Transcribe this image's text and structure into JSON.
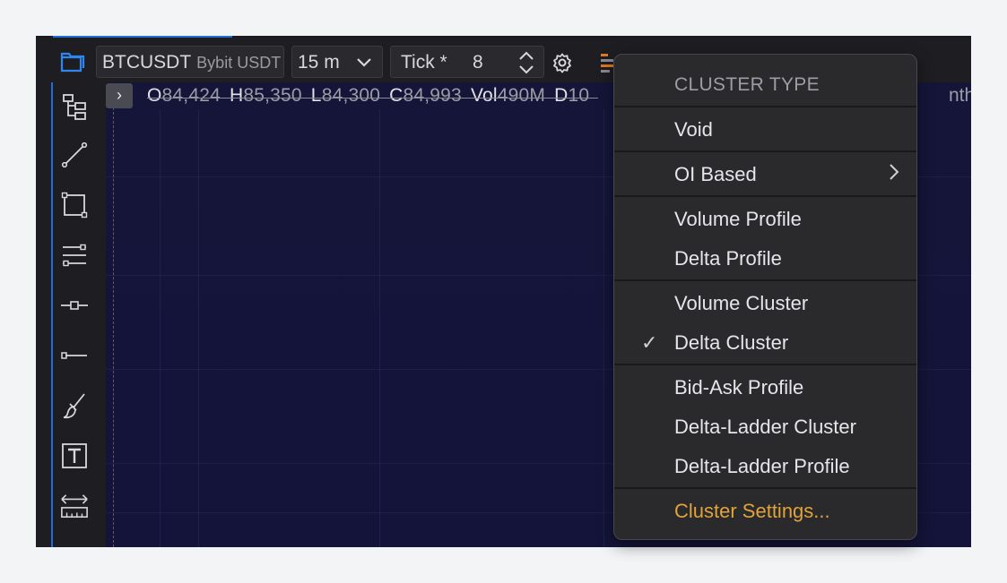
{
  "toolbar": {
    "symbol": "BTCUSDT",
    "exchange": "Bybit USDT",
    "interval": "15 m",
    "tick_label": "Tick *",
    "tick_value": "8"
  },
  "ohlc": {
    "o_label": "O",
    "o_value": "84,424",
    "h_label": "H",
    "h_value": "85,350",
    "l_label": "L",
    "l_value": "84,300",
    "c_label": "C",
    "c_value": "84,993",
    "vol_label": "Vol",
    "vol_value": "490M",
    "d_label": "D",
    "d_value": "10"
  },
  "chart_right_text": "ntheti",
  "menu": {
    "header": "CLUSTER TYPE",
    "items": [
      {
        "label": "Void"
      },
      {
        "label": "OI Based",
        "submenu": true
      },
      {
        "label": "Volume Profile"
      },
      {
        "label": "Delta Profile"
      },
      {
        "label": "Volume Cluster"
      },
      {
        "label": "Delta Cluster",
        "checked": true
      },
      {
        "label": "Bid-Ask Profile"
      },
      {
        "label": "Delta-Ladder Cluster"
      },
      {
        "label": "Delta-Ladder Profile"
      }
    ],
    "settings": "Cluster Settings...",
    "check_glyph": "✓",
    "arrow_glyph": "›"
  },
  "colors": {
    "accent": "#1f6fd9",
    "chart_bg": "#15153a",
    "menu_bg": "#2a2a2d",
    "settings_text": "#e0a43a"
  },
  "icons": {
    "folder": "folder-icon",
    "gear": "gear-icon",
    "cluster": "cluster-chart-icon",
    "tools": [
      "anchor-tree-icon",
      "trend-line-icon",
      "rectangle-icon",
      "parallel-channel-icon",
      "horizontal-ray-icon",
      "ray-line-icon",
      "brush-icon",
      "text-icon",
      "ruler-icon"
    ]
  }
}
